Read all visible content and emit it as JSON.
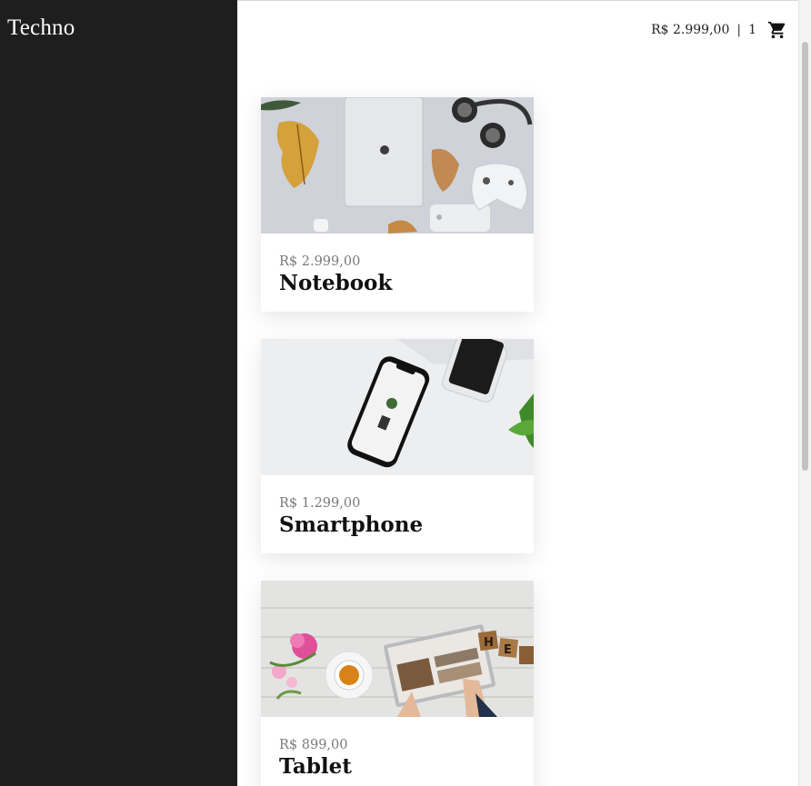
{
  "brand": {
    "logo": "Techno"
  },
  "header": {
    "cart_total": "R$ 2.999,00",
    "separator": "|",
    "cart_count": "1",
    "cart_icon": "shopping-cart-icon"
  },
  "products": [
    {
      "price": "R$ 2.999,00",
      "name": "Notebook",
      "image": "notebook-flatlay-photo"
    },
    {
      "price": "R$ 1.299,00",
      "name": "Smartphone",
      "image": "smartphone-desk-photo"
    },
    {
      "price": "R$ 899,00",
      "name": "Tablet",
      "image": "tablet-table-photo"
    }
  ],
  "colors": {
    "sidebar_bg": "#1e1e1e",
    "main_bg": "#ffffff",
    "price_text": "#7a7a7a",
    "name_text": "#111111"
  }
}
